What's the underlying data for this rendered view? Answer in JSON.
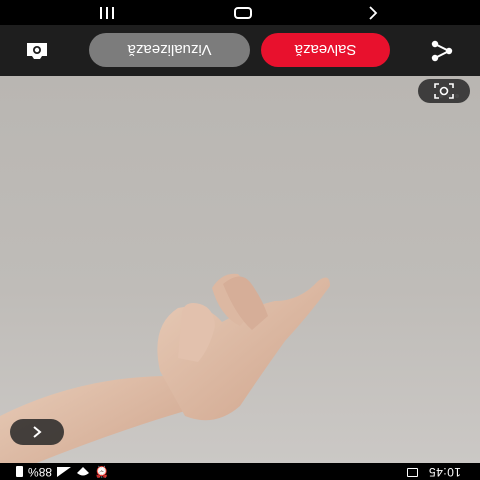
{
  "status_bar": {
    "time": "10:45",
    "battery_percent": "88%",
    "icons": [
      "gallery-icon",
      "signal-icon",
      "wifi-icon",
      "alarm-icon",
      "battery-icon"
    ]
  },
  "actions": {
    "save_label": "Salvează",
    "view_label": "Vizualizează",
    "save_color": "#e8112d",
    "view_color": "#7c7c7c"
  },
  "photo": {
    "icons": [
      "back-icon",
      "more-options-icon",
      "google-lens-icon"
    ]
  },
  "nav": {
    "icons": [
      "nav-back-icon",
      "nav-home-icon",
      "nav-recents-icon"
    ]
  }
}
